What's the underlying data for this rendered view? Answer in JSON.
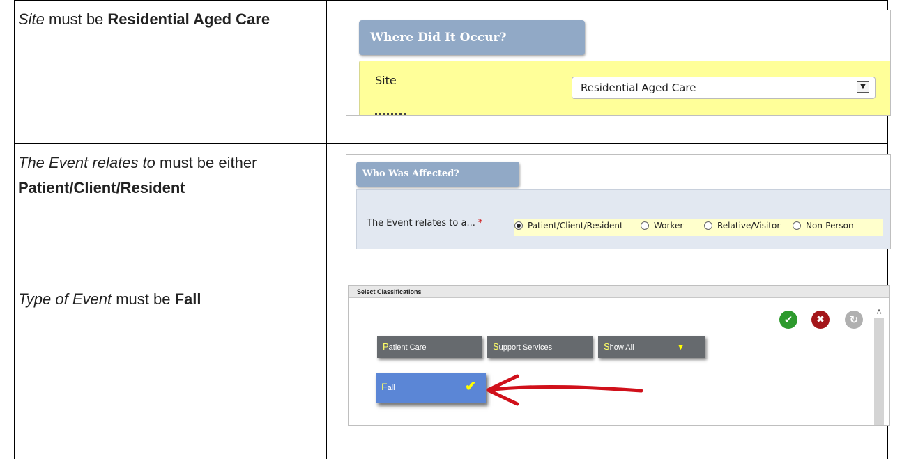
{
  "rows": [
    {
      "description": {
        "field": "Site",
        "middle": " must be ",
        "value": "Residential Aged Care"
      },
      "panel": {
        "header": "Where Did It Occur?",
        "site_label": "Site",
        "site_value": "Residential Aged Care",
        "dropdown_icon": "chevron-down-icon"
      }
    },
    {
      "description": {
        "field": "The Event relates to",
        "middle": " must be either ",
        "value": "Patient/Client/Resident"
      },
      "panel": {
        "header": "Who Was Affected?",
        "question": "The Event relates to a...",
        "required_mark": "*",
        "options": [
          "Patient/Client/Resident",
          "Worker",
          "Relative/Visitor",
          "Non-Person"
        ],
        "selected": "Patient/Client/Resident"
      }
    },
    {
      "description": {
        "field": "Type of Event",
        "middle": " must be ",
        "value": "Fall"
      },
      "panel": {
        "header": "Select Classifications",
        "categories": [
          {
            "first": "P",
            "rest": "atient Care"
          },
          {
            "first": "S",
            "rest": "upport Services"
          },
          {
            "first": "S",
            "rest": "how All"
          }
        ],
        "selected_item": {
          "first": "F",
          "rest": "all"
        },
        "icons": [
          "check-circle-icon",
          "close-circle-icon",
          "undo-circle-icon",
          "filter-icon",
          "checkmark-icon",
          "red-arrow-icon"
        ],
        "colors": {
          "ok": "#2d9a2d",
          "cancel": "#a4161a",
          "undo": "#b0b0b0",
          "selected": "#5b86d6",
          "arrow": "#d0101a"
        }
      }
    }
  ]
}
